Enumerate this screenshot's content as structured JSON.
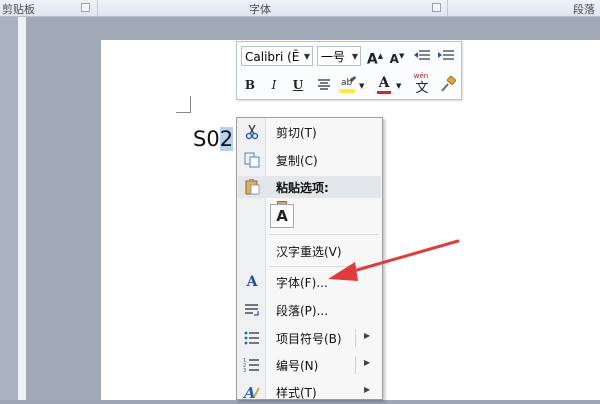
{
  "ribbon": {
    "groups": [
      {
        "label": "剪贴板"
      },
      {
        "label": "字体"
      },
      {
        "label": "段落"
      }
    ]
  },
  "document": {
    "text_prefix": "S0",
    "text_selected": "2"
  },
  "mini_toolbar": {
    "font_name": "Calibri (Ē",
    "font_size": "一号",
    "grow_font": "A",
    "shrink_font": "A",
    "bold": "B",
    "italic": "I",
    "underline": "U",
    "font_color_letter": "A",
    "highlight_color": "#ffeb3b",
    "font_color": "#e02020",
    "phonetic_label": "wén",
    "phonetic_char": "文"
  },
  "context_menu": {
    "items": [
      {
        "label": "剪切(T)",
        "icon": "scissors-icon"
      },
      {
        "label": "复制(C)",
        "icon": "copy-icon"
      },
      {
        "label": "粘贴选项:",
        "icon": "paste-icon"
      },
      {
        "label": "A",
        "icon": "keep-text-only-icon"
      },
      {
        "label": "汉字重选(V)",
        "icon": ""
      },
      {
        "label": "字体(F)...",
        "icon": "font-icon"
      },
      {
        "label": "段落(P)...",
        "icon": "paragraph-icon"
      },
      {
        "label": "项目符号(B)",
        "icon": "bullets-icon"
      },
      {
        "label": "编号(N)",
        "icon": "numbering-icon"
      },
      {
        "label": "样式(T)",
        "icon": "styles-icon"
      }
    ]
  },
  "annotation": {
    "arrow_color": "#e03c3c"
  }
}
